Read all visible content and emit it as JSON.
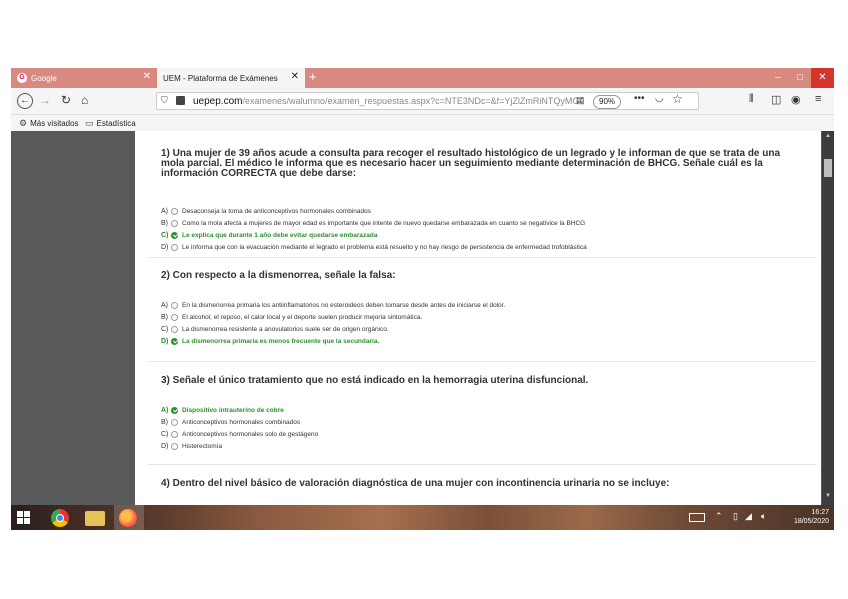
{
  "browser": {
    "tabs": [
      {
        "label": "Google",
        "favicon": "G"
      },
      {
        "label": "UEM - Plataforma de Exámenes"
      }
    ],
    "new_tab_symbol": "+",
    "window_controls": {
      "minimize": "–",
      "maximize": "□",
      "close": "✕"
    },
    "url_domain": "uepep.com",
    "url_path": "/examenes/walumno/examen_respuestas.aspx?c=NTE3NDc=&f=YjZlZmRiNTQyMGQ",
    "zoom": "90%",
    "bookmarks": [
      "Más visitados",
      "Estadística"
    ]
  },
  "questions": [
    {
      "title": "1) Una mujer de 39 años acude a consulta para recoger el resultado histológico de un legrado y le informan de que se trata de una mola parcial. El médico le informa que es necesario hacer un seguimiento mediante determinación de BHCG. Señale cuál es la información CORRECTA que debe darse:",
      "options": [
        {
          "letter": "A)",
          "text": "Desaconseja la toma de anticonceptivos hormonales combinados"
        },
        {
          "letter": "B)",
          "text": "Como la mola afecta a mujeres de mayor edad es importante que intente de nuevo quedarse embarazada en cuanto se negativice la BHCG"
        },
        {
          "letter": "C)",
          "text": "Le explica que durante 1 año debe evitar quedarse embarazada"
        },
        {
          "letter": "D)",
          "text": "Le informa que con la evacuación mediante el legrado el problema está resuelto y no hay riesgo de persistencia de enfermedad trofoblástica"
        }
      ]
    },
    {
      "title": "2) Con respecto a la dismenorrea, señale la falsa:",
      "options": [
        {
          "letter": "A)",
          "text": "En la dismenorrea primaria los antiinflamatorios no esteroideos deben tomarse desde antes de iniciarse el dolor."
        },
        {
          "letter": "B)",
          "text": "El alcohol, el reposo, el calor local y el deporte suelen producir mejoría sintomática."
        },
        {
          "letter": "C)",
          "text": "La dismenorrea resistente a anovulatorios suele ser de origen orgánico."
        },
        {
          "letter": "D)",
          "text": "La dismenorrea primaria es menos frecuente que la secundaria."
        }
      ]
    },
    {
      "title": "3) Señale el único tratamiento que no está indicado en la hemorragia uterina disfuncional.",
      "options": [
        {
          "letter": "A)",
          "text": "Dispositivo intrauterino de cobre"
        },
        {
          "letter": "B)",
          "text": "Anticonceptivos hormonales combinados"
        },
        {
          "letter": "C)",
          "text": "Anticonceptivos hormonales solo de gestágeno"
        },
        {
          "letter": "D)",
          "text": "Histerectomía"
        }
      ]
    },
    {
      "title": "4) Dentro del nivel básico de valoración diagnóstica de una mujer con incontinencia urinaria no se incluye:"
    }
  ],
  "taskbar": {
    "time": "16:27",
    "date": "18/05/2020"
  },
  "colors": {
    "correct": "#2f8f2f",
    "tabbar": "#d88a80",
    "close": "#d7352b"
  }
}
